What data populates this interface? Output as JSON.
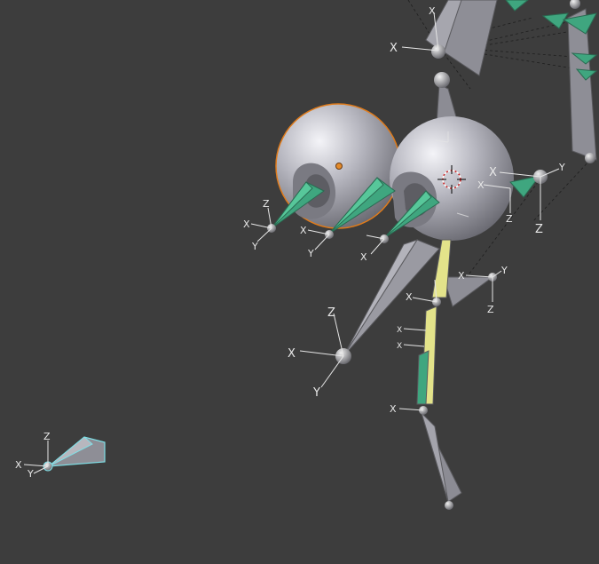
{
  "scene": {
    "editor": "3D viewport",
    "background": "#3d3d3d",
    "bone_color": "#8c8c94",
    "bone_selected_color": "#e3e38a",
    "bone_deform_color": "#3fa67f",
    "selected_outline": "#e07b1a",
    "active_outline": "#7fdfe6",
    "cursor_color": "#cc2020"
  },
  "axis_labels": {
    "x": "X",
    "y": "Y",
    "z": "Z"
  },
  "icons": {
    "cursor": "3d-cursor-icon",
    "origin": "object-origin-icon"
  }
}
